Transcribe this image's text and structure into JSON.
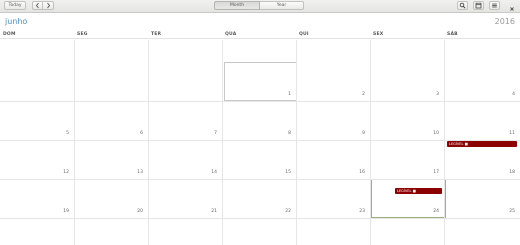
{
  "toolbar": {
    "today_label": "Today",
    "prev_icon": "chevron-left-icon",
    "next_icon": "chevron-right-icon",
    "view_month_label": "Month",
    "view_year_label": "Year",
    "search_icon": "search-icon",
    "calendars_icon": "calendar-list-icon",
    "menu_icon": "menu-icon",
    "close_icon": "close-icon"
  },
  "calendar": {
    "month": "junho",
    "year": "2016",
    "weekdays": [
      "DOM",
      "SEG",
      "TER",
      "QUA",
      "QUI",
      "SEX",
      "SÁB"
    ],
    "weeks": [
      [
        "",
        "",
        "",
        "1",
        "2",
        "3",
        "4"
      ],
      [
        "5",
        "6",
        "7",
        "8",
        "9",
        "10",
        "11"
      ],
      [
        "12",
        "13",
        "14",
        "15",
        "16",
        "17",
        "18"
      ],
      [
        "19",
        "20",
        "21",
        "22",
        "23",
        "24",
        "25"
      ]
    ],
    "events": [
      {
        "label": "LEGÍVEL ■",
        "color": "#8b0000"
      },
      {
        "label": "LEGÍVEL ■",
        "color": "#8b0000"
      }
    ]
  }
}
